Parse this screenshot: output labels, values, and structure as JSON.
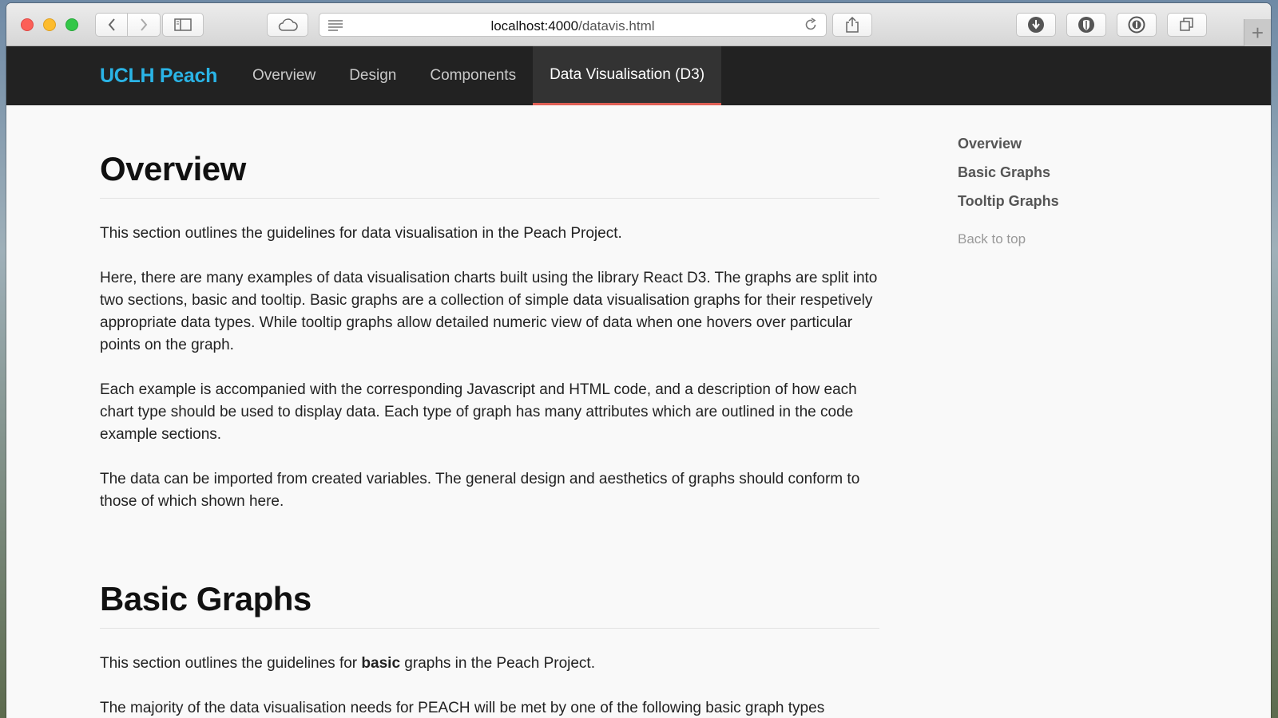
{
  "browser": {
    "url_host": "localhost:4000",
    "url_path": "/datavis.html",
    "icons": {
      "back": "chevron-left-icon",
      "forward": "chevron-right-icon",
      "sidebar": "sidebar-icon",
      "cloud": "cloud-icon",
      "reader": "reader-icon",
      "reload": "reload-icon",
      "share": "share-icon",
      "download": "download-icon",
      "extension": "shield-icon",
      "password": "password-icon",
      "tabs": "tabs-overview-icon",
      "new_tab": "plus-icon"
    },
    "new_tab_glyph": "+"
  },
  "navbar": {
    "brand": "UCLH Peach",
    "brand_color": "#2ab4e6",
    "active_underline_color": "#e05f55",
    "items": [
      {
        "label": "Overview"
      },
      {
        "label": "Design"
      },
      {
        "label": "Components"
      },
      {
        "label": "Data Visualisation (D3)",
        "active": true
      }
    ]
  },
  "overview": {
    "title": "Overview",
    "paragraphs": [
      "This section outlines the guidelines for data visualisation in the Peach Project.",
      "Here, there are many examples of data visualisation charts built using the library React D3. The graphs are split into two sections, basic and tooltip. Basic graphs are a collection of simple data visualisation graphs for their respetively appropriate data types. While tooltip graphs allow detailed numeric view of data when one hovers over particular points on the graph.",
      "Each example is accompanied with the corresponding Javascript and HTML code, and a description of how each chart type should be used to display data. Each type of graph has many attributes which are outlined in the code example sections.",
      "The data can be imported from created variables. The general design and aesthetics of graphs should conform to those of which shown here."
    ]
  },
  "basic": {
    "title": "Basic Graphs",
    "intro_before": "This section outlines the guidelines for ",
    "intro_bold": "basic",
    "intro_after": " graphs in the Peach Project.",
    "partial": "The majority of the data visualisation needs for PEACH will be met by one of the following basic graph types"
  },
  "sidenav": {
    "links": [
      {
        "label": "Overview"
      },
      {
        "label": "Basic Graphs"
      },
      {
        "label": "Tooltip Graphs"
      }
    ],
    "back_to_top": "Back to top"
  }
}
